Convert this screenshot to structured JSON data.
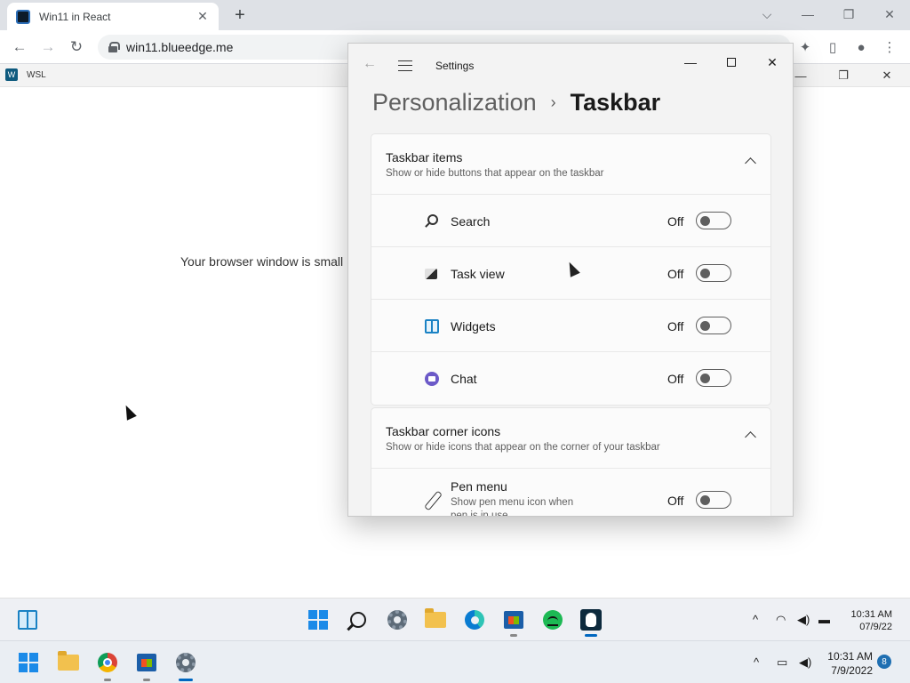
{
  "browser": {
    "tab_title": "Win11 in React",
    "tab_close": "✕",
    "new_tab": "+",
    "url": "win11.blueedge.me",
    "controls": {
      "chevron": "⌵",
      "minimize": "—",
      "restore": "❐",
      "close": "✕"
    }
  },
  "app_bar": {
    "label": "WSL",
    "icon_glyph": "W"
  },
  "background": {
    "message": "Your browser window is small"
  },
  "settings": {
    "app_title": "Settings",
    "back_glyph": "←",
    "breadcrumb": {
      "parent": "Personalization",
      "separator": "›",
      "current": "Taskbar"
    },
    "controls": {
      "minimize": "—",
      "close": "✕"
    },
    "taskbar_items": {
      "title": "Taskbar items",
      "subtitle": "Show or hide buttons that appear on the taskbar",
      "items": [
        {
          "label": "Search",
          "state": "Off",
          "icon": "search-icon"
        },
        {
          "label": "Task view",
          "state": "Off",
          "icon": "task-view-icon"
        },
        {
          "label": "Widgets",
          "state": "Off",
          "icon": "widgets-icon"
        },
        {
          "label": "Chat",
          "state": "Off",
          "icon": "chat-icon"
        }
      ]
    },
    "corner_icons": {
      "title": "Taskbar corner icons",
      "subtitle": "Show or hide icons that appear on the corner of your taskbar",
      "items": [
        {
          "label": "Pen menu",
          "description": "Show pen menu icon when pen is in use",
          "state": "Off",
          "icon": "pen-icon"
        }
      ]
    }
  },
  "inner_taskbar": {
    "time": "10:31 AM",
    "date": "07/9/22",
    "tray_up": "^",
    "icons": [
      "widgets-icon",
      "start-icon",
      "search-icon",
      "settings-icon",
      "file-explorer-icon",
      "edge-icon",
      "store-icon",
      "spotify-icon",
      "wsl-icon"
    ]
  },
  "host_taskbar": {
    "time": "10:31 AM",
    "date": "7/9/2022",
    "badge": "8",
    "tray_up": "^",
    "icons": [
      "start-icon",
      "file-explorer-icon",
      "chrome-icon",
      "store-icon",
      "settings-icon"
    ]
  },
  "colors": {
    "accent": "#0067c0",
    "settings_bg": "#f3f3f3",
    "card_bg": "#fbfbfb",
    "taskbar_bg": "#eaeef3"
  }
}
